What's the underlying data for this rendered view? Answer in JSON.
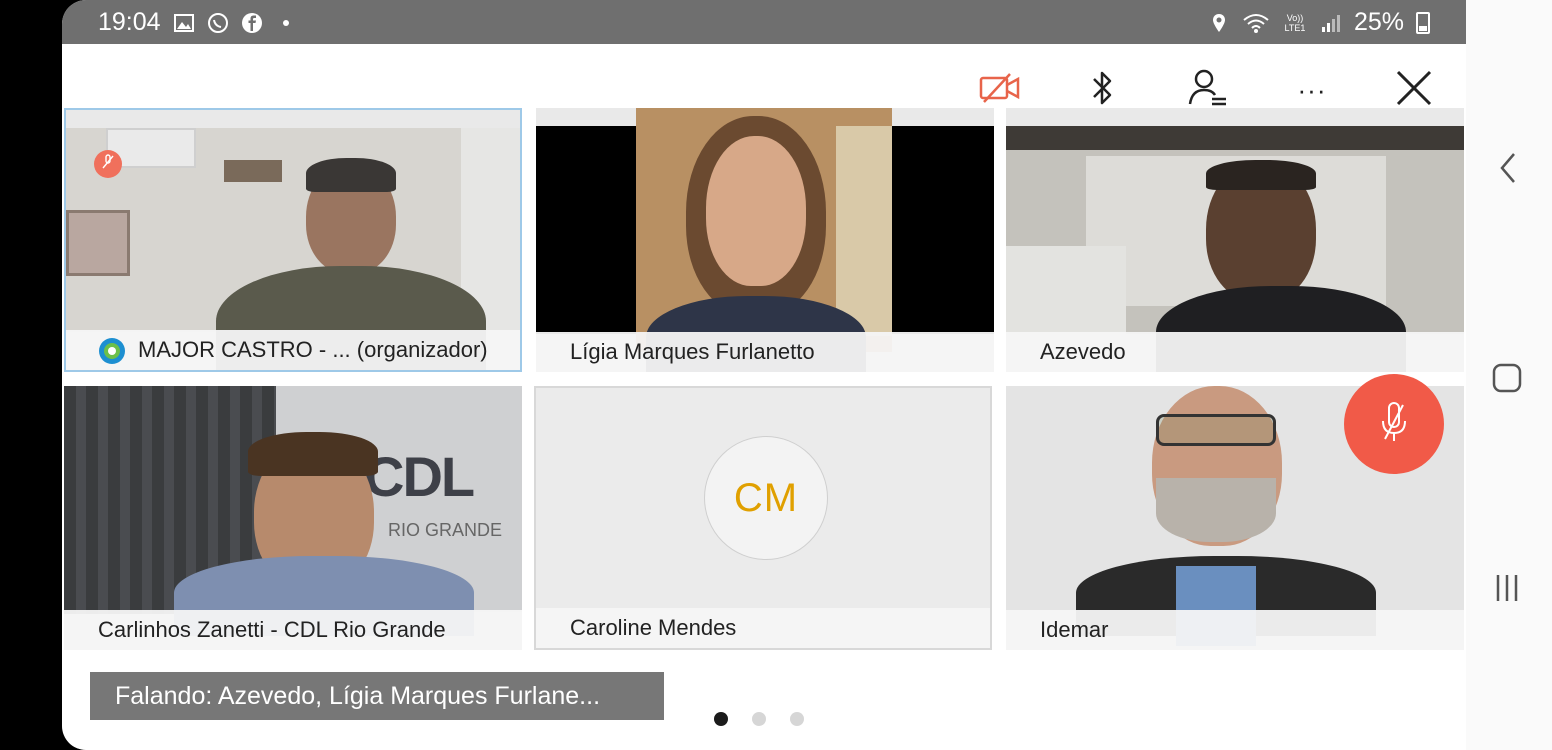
{
  "status_bar": {
    "time": "19:04",
    "battery": "25%",
    "left_icons": [
      "gallery-icon",
      "whatsapp-icon",
      "facebook-icon",
      "notification-dot-icon"
    ],
    "right_icons": [
      "location-icon",
      "wifi-icon",
      "volte-lte-icon",
      "signal-icon",
      "battery-icon"
    ],
    "volte_label": "Vo)) LTE1"
  },
  "toolbar": {
    "buttons": [
      "camera-off-icon",
      "bluetooth-icon",
      "participants-icon",
      "more-options-icon",
      "close-icon"
    ],
    "more_label": "···",
    "accent": "#e8644a"
  },
  "participants": [
    {
      "name": "MAJOR CASTRO - ... (organizador)",
      "muted": true,
      "active": true
    },
    {
      "name": "Lígia Marques Furlanetto",
      "muted": false,
      "active": false
    },
    {
      "name": "Azevedo",
      "muted": false,
      "active": false
    },
    {
      "name": "Carlinhos Zanetti - CDL Rio Grande",
      "muted": false,
      "active": false,
      "backdrop_text": "CDL",
      "backdrop_subtext": "RIO GRANDE"
    },
    {
      "name": "Caroline Mendes",
      "initials": "CM",
      "muted": false,
      "active": false
    },
    {
      "name": "Idemar",
      "muted": false,
      "active": false
    }
  ],
  "mute_button": {
    "icon": "microphone-muted-icon",
    "color": "#f15a48"
  },
  "speaking": {
    "text": "Falando: Azevedo, Lígia Marques Furlane..."
  },
  "pagination": {
    "pages": 3,
    "current": 1
  },
  "nav_bar": {
    "buttons": [
      "back-icon",
      "home-icon",
      "recents-icon"
    ]
  },
  "colors": {
    "avatar_initials": "#e0a000",
    "active_border": "#9ec9e8",
    "status_bar": "#6f6f6f"
  }
}
